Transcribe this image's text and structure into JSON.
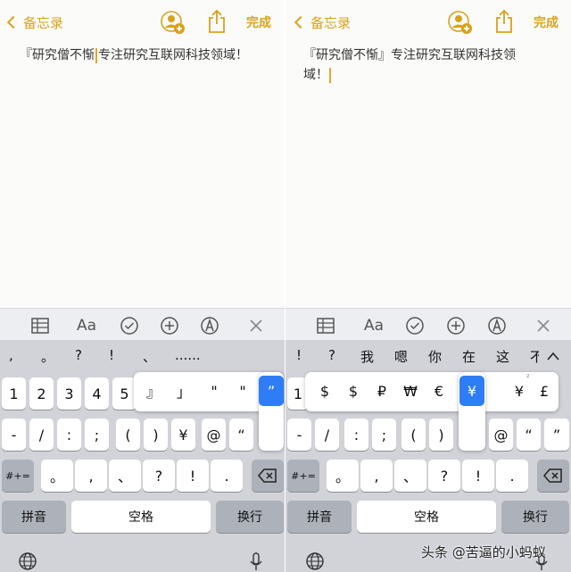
{
  "nav": {
    "back_label": "备忘录",
    "done_label": "完成"
  },
  "note": {
    "left_text_before": "『研究僧不惭",
    "left_text_after": "专注研究互联网科技领域！",
    "right_text_before": "『研究僧不惭』专注研究互联网科技领域！"
  },
  "toolbar": {
    "format_label": "Aa"
  },
  "left": {
    "candidates": [
      ",",
      "。",
      "?",
      "!",
      "、",
      "......"
    ],
    "row1": [
      "1",
      "2",
      "3",
      "4",
      "5"
    ],
    "popup": [
      "』",
      "」",
      "\"",
      "\"",
      "”"
    ],
    "row2": [
      "-",
      "/",
      ":",
      ";",
      "(",
      ")",
      "¥",
      "@",
      "“"
    ],
    "row3": [
      "。",
      ",",
      "、",
      "?",
      "!",
      "."
    ],
    "mode_key": "#+=",
    "pinyin": "拼音",
    "space": "空格",
    "return": "换行"
  },
  "right": {
    "candidates": [
      "!",
      "?",
      "我",
      "嗯",
      "你",
      "在",
      "这",
      "不"
    ],
    "row1": [
      "1"
    ],
    "popup": [
      "$",
      "$",
      "₽",
      "₩",
      "€",
      "¥",
      "¥",
      "£"
    ],
    "popup_sup": "²",
    "row2": [
      "-",
      "/",
      ":",
      ";",
      "(",
      ")",
      "@",
      "“",
      "”"
    ],
    "row3": [
      "。",
      ",",
      "、",
      "?",
      "!",
      "."
    ],
    "mode_key": "#+=",
    "pinyin": "拼音",
    "space": "空格",
    "return": "换行"
  },
  "watermark": "头条 @苦逼的小蚂蚁",
  "colors": {
    "accent": "#d9a21b",
    "selected": "#2f7df6",
    "keyboard_bg": "#d1d3d9"
  }
}
